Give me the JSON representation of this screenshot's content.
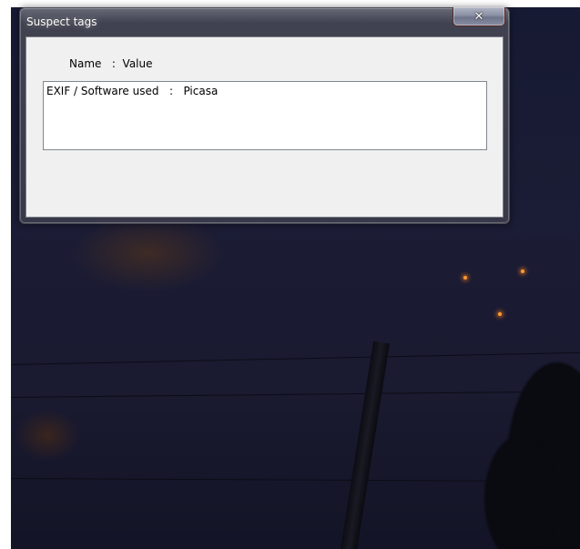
{
  "window": {
    "title": "Suspect tags",
    "close_glyph": "✕"
  },
  "header": {
    "name_label": "Name",
    "separator": ":",
    "value_label": "Value"
  },
  "list": {
    "items": [
      {
        "name": "EXIF / Software used",
        "separator": ":",
        "value": "Picasa"
      }
    ]
  },
  "icons": {
    "close": "close-icon"
  }
}
